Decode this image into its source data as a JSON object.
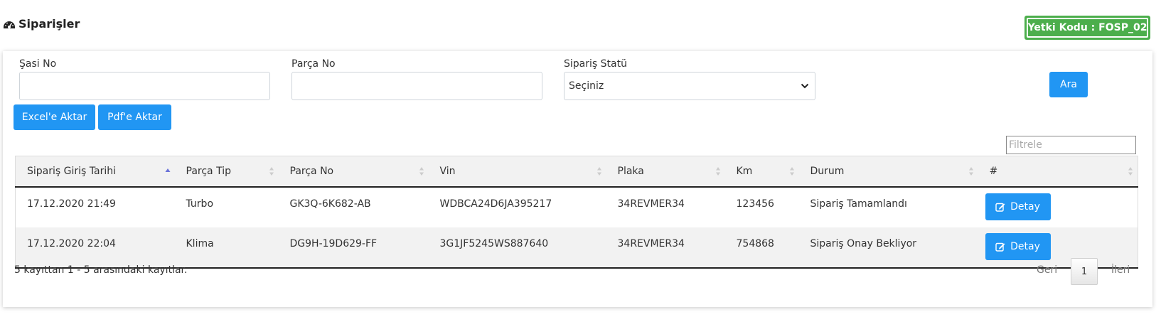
{
  "page": {
    "title": "Siparişler",
    "icon": "dashboard-icon"
  },
  "auth_badge": {
    "text": "Yetki Kodu : FOSP_02",
    "color": "#4cae4c"
  },
  "filters": {
    "sasi_no": {
      "label": "Şasi No",
      "value": "",
      "placeholder": ""
    },
    "parca_no": {
      "label": "Parça No",
      "value": "",
      "placeholder": ""
    },
    "siparis_statu": {
      "label": "Sipariş Statü",
      "selected": "Seçiniz"
    },
    "search_button": "Ara"
  },
  "export": {
    "excel_label": "Excel'e Aktar",
    "pdf_label": "Pdf'e Aktar"
  },
  "table_filter": {
    "placeholder": "Filtrele",
    "value": ""
  },
  "table": {
    "columns": [
      "Sipariş Giriş Tarihi",
      "Parça Tip",
      "Parça No",
      "Vin",
      "Plaka",
      "Km",
      "Durum",
      "#"
    ],
    "sorted_column": "Sipariş Giriş Tarihi",
    "sort_direction": "ascending",
    "rows": [
      {
        "tarih": "17.12.2020 21:49",
        "parca_tip": "Turbo",
        "parca_no": "GK3Q-6K682-AB",
        "vin": "WDBCA24D6JA395217",
        "plaka": "34REVMER34",
        "km": "123456",
        "durum": "Sipariş Tamamlandı",
        "action": "Detay"
      },
      {
        "tarih": "17.12.2020 22:04",
        "parca_tip": "Klima",
        "parca_no": "DG9H-19D629-FF",
        "vin": "3G1JF5245WS887640",
        "plaka": "34REVMER34",
        "km": "754868",
        "durum": "Sipariş Onay Bekliyor",
        "action": "Detay"
      }
    ]
  },
  "footer": {
    "info": "5 kayıttan 1 - 5 arasındaki kayıtlar.",
    "prev": "Geri",
    "current_page": "1",
    "next": "İleri"
  },
  "colors": {
    "primary": "#2196f3",
    "success": "#4cae4c"
  }
}
